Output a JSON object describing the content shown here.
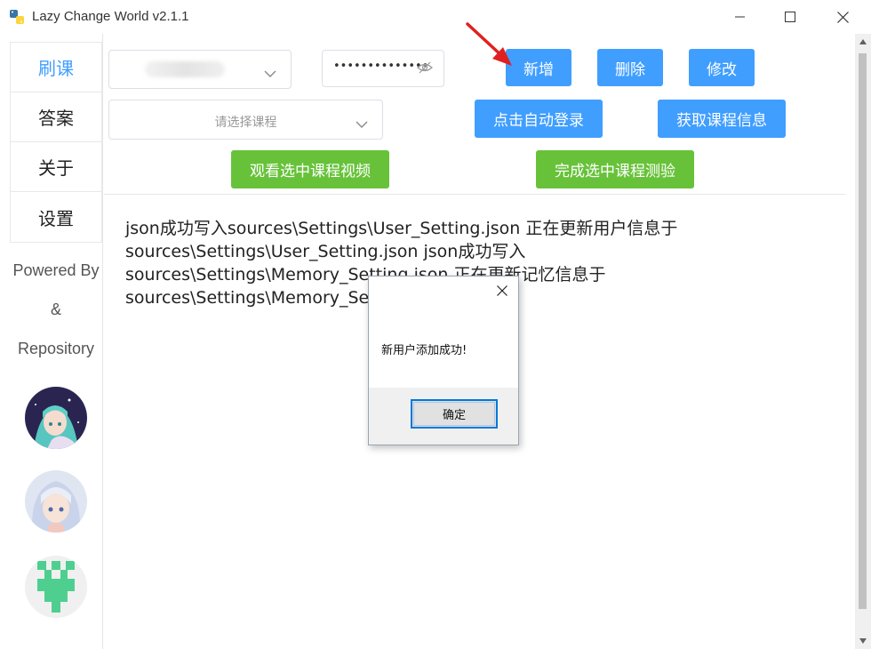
{
  "window": {
    "title": "Lazy Change World v2.1.1"
  },
  "sidebar": {
    "items": [
      {
        "label": "刷课",
        "active": true
      },
      {
        "label": "答案",
        "active": false
      },
      {
        "label": "关于",
        "active": false
      },
      {
        "label": "设置",
        "active": false
      }
    ],
    "powered_by": "Powered By",
    "ampersand": "&",
    "repository": "Repository"
  },
  "form": {
    "user_select_value": "",
    "password_mask": "••••••••••••••",
    "course_placeholder": "请选择课程"
  },
  "buttons": {
    "add": "新增",
    "delete": "删除",
    "modify": "修改",
    "auto_login": "点击自动登录",
    "get_course_info": "获取课程信息",
    "watch_video": "观看选中课程视频",
    "complete_quiz": "完成选中课程测验"
  },
  "log": {
    "lines": [
      "json成功写入sources\\Settings\\User_Setting.json 正在更新用户信息于",
      "sources\\Settings\\User_Setting.json json成功写入",
      "sources\\Settings\\Memory_Setting.json 正在更新记忆信息于",
      "sources\\Settings\\Memory_Se"
    ]
  },
  "dialog": {
    "message": "新用户添加成功!",
    "ok_label": "确定"
  },
  "colors": {
    "primary": "#409eff",
    "success": "#67c23a",
    "annotation": "#e02020"
  }
}
